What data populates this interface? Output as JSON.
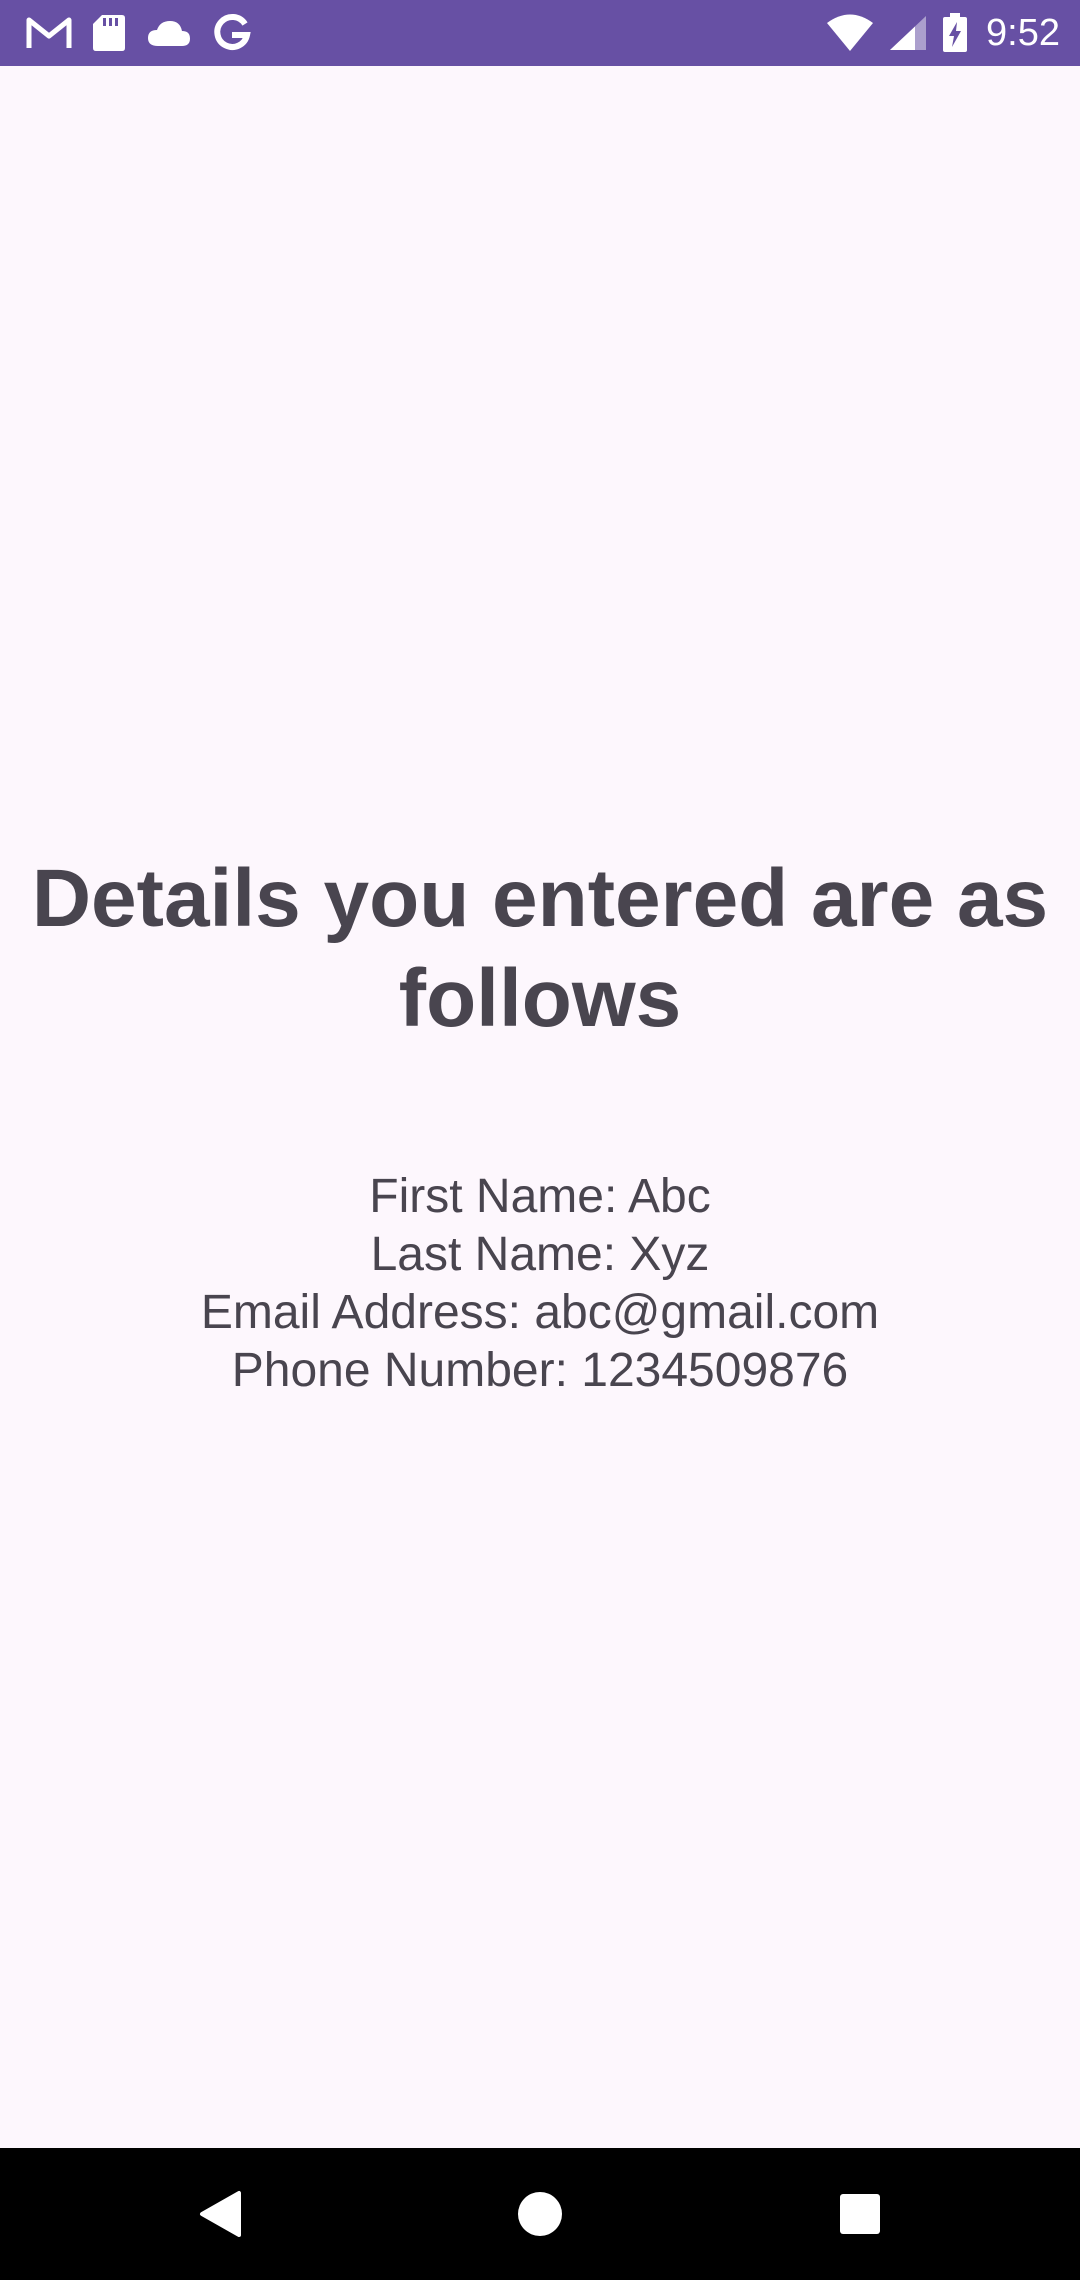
{
  "status_bar": {
    "time": "9:52",
    "bg_color": "#6750A4",
    "left_icons": [
      "gmail-icon",
      "sd-card-icon",
      "cloud-icon",
      "google-icon"
    ],
    "right_icons": [
      "wifi-icon",
      "cell-signal-icon",
      "battery-charging-icon"
    ]
  },
  "main": {
    "title": "Details you entered are as follows",
    "details": {
      "first_name": "First Name: Abc",
      "last_name": "Last Name: Xyz",
      "email": "Email Address: abc@gmail.com",
      "phone": "Phone Number: 1234509876"
    },
    "text_color": "#49454F",
    "bg_color": "#FDF7FD"
  },
  "nav_bar": {
    "buttons": [
      "back-icon",
      "home-icon",
      "recents-icon"
    ]
  }
}
